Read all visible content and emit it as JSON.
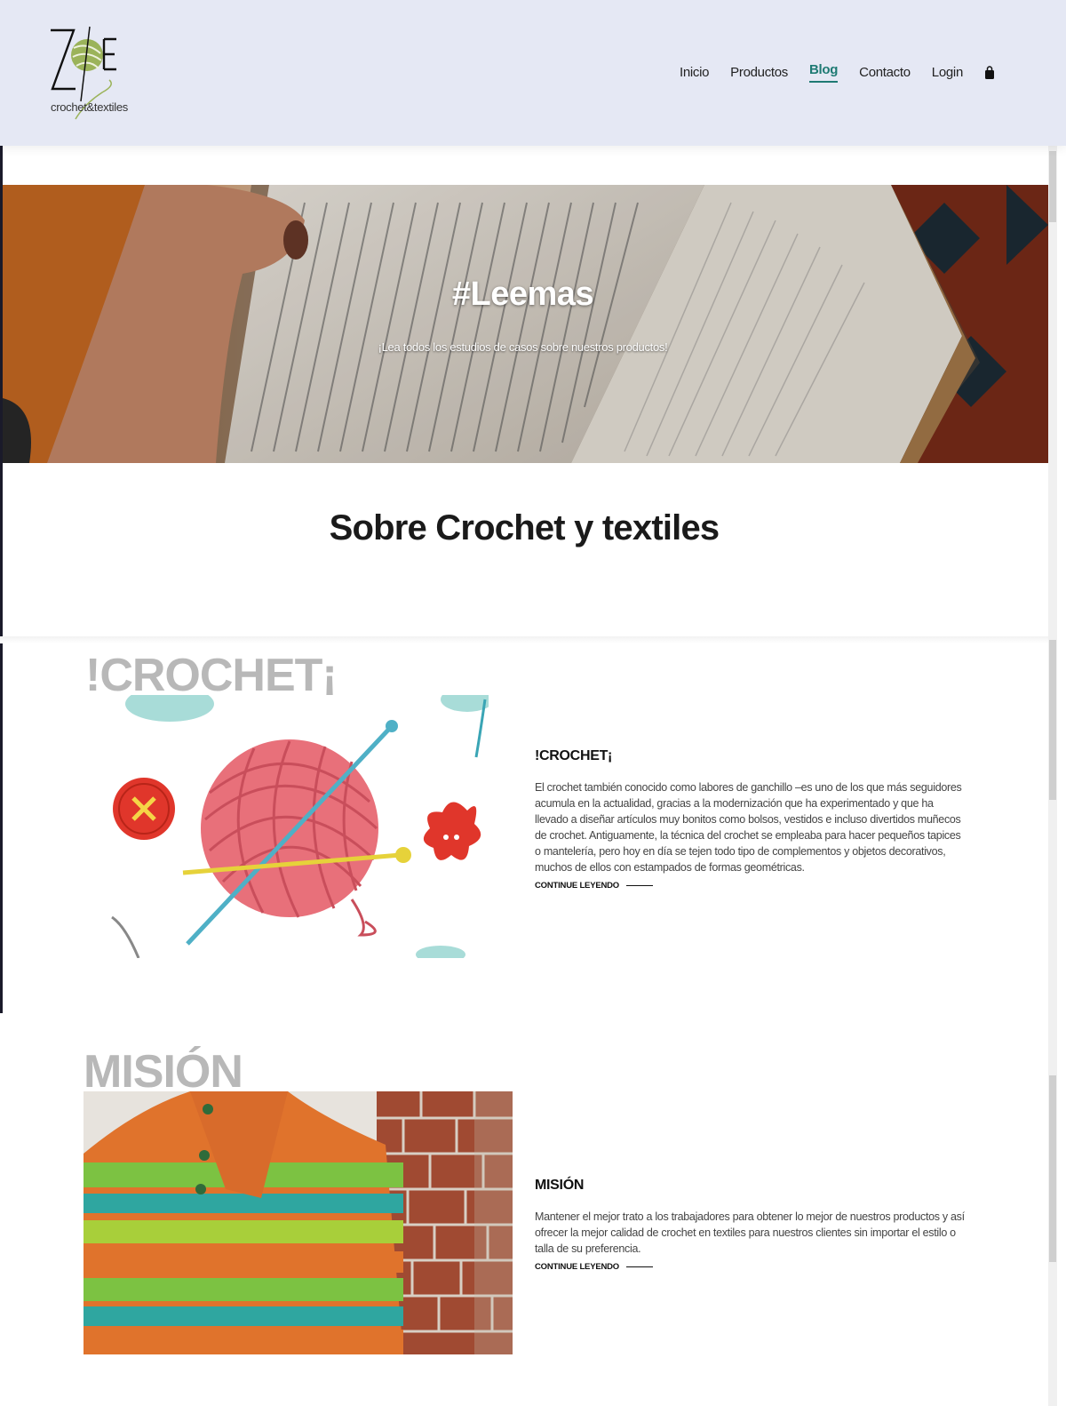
{
  "header": {
    "logo_text": "crochet&textiles",
    "nav": [
      "Inicio",
      "Productos",
      "Blog",
      "Contacto",
      "Login"
    ],
    "active_nav": "Blog",
    "cart_icon": "shopping-bag-icon"
  },
  "hero": {
    "title": "#Leemas",
    "subtitle": "¡Lea todos los estudios de casos sobre nuestros productos!"
  },
  "section": {
    "title": "Sobre Crochet y textiles"
  },
  "posts": [
    {
      "big_label": "!CROCHET¡",
      "heading": "!CROCHET¡",
      "body": "El crochet también conocido como labores de ganchillo –es uno de los que más seguidores acumula en la actualidad, gracias a la modernización que ha experimentado y que ha llevado a diseñar artículos muy bonitos como bolsos, vestidos e incluso divertidos muñecos de crochet. Antiguamente, la técnica del crochet se empleaba para hacer pequeños tapices o mantelería, pero hoy en día se tejen todo tipo de complementos y objetos decorativos, muchos de ellos con estampados de formas geométricas.",
      "link": "CONTINUE LEYENDO"
    },
    {
      "big_label": "MISIÓN",
      "heading": "MISIÓN",
      "body": "Mantener el mejor trato a los trabajadores para obtener lo mejor de nuestros productos y así ofrecer la mejor calidad de crochet en textiles para nuestros clientes sin importar el estilo o talla de su preferencia.",
      "link": "CONTINUE LEYENDO"
    }
  ],
  "colors": {
    "header_bg": "#e5e8f4",
    "accent": "#1e7a73",
    "big_label": "#b8b8b8"
  }
}
